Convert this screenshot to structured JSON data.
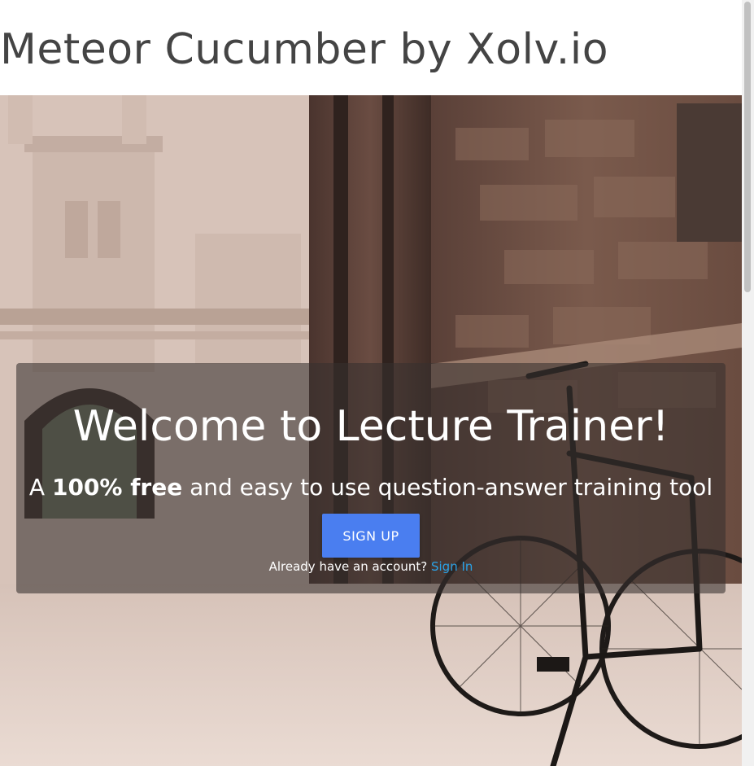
{
  "header": {
    "title": "Meteor Cucumber by Xolv.io"
  },
  "hero": {
    "heading": "Welcome to Lecture Trainer!",
    "tagline_prefix": "A ",
    "tagline_bold": "100% free",
    "tagline_suffix": " and easy to use question-answer training tool",
    "signup_label": "SIGN UP",
    "account_prompt": "Already have an account? ",
    "signin_label": "Sign In"
  },
  "colors": {
    "title_text": "#444444",
    "signup_button": "#4a7ef0",
    "signin_link": "#2aa2e6",
    "overlay": "rgba(55, 48, 46, 0.58)"
  }
}
